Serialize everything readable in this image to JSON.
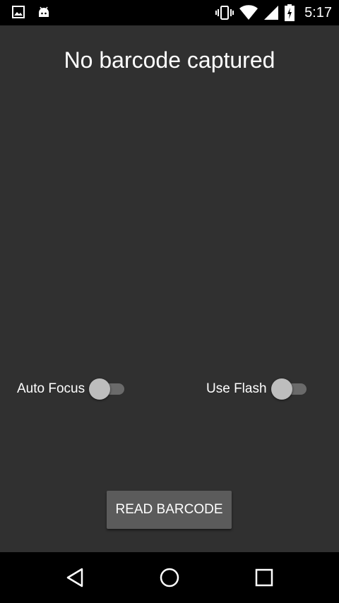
{
  "status_bar": {
    "time": "5:17",
    "icons_left": [
      "image-icon",
      "android-icon"
    ],
    "icons_right": [
      "vibrate-icon",
      "wifi-icon",
      "signal-icon",
      "battery-icon"
    ]
  },
  "main": {
    "barcode_status": "No barcode captured",
    "options": {
      "auto_focus": {
        "label": "Auto Focus",
        "enabled": false
      },
      "use_flash": {
        "label": "Use Flash",
        "enabled": false
      }
    },
    "read_button_label": "READ BARCODE"
  },
  "nav_bar": {
    "buttons": [
      "back-icon",
      "home-icon",
      "recents-icon"
    ]
  },
  "colors": {
    "background": "#303030",
    "button": "#5b5b5b",
    "switch_track": "#6a6a6a",
    "switch_thumb": "#bdbdbd"
  }
}
